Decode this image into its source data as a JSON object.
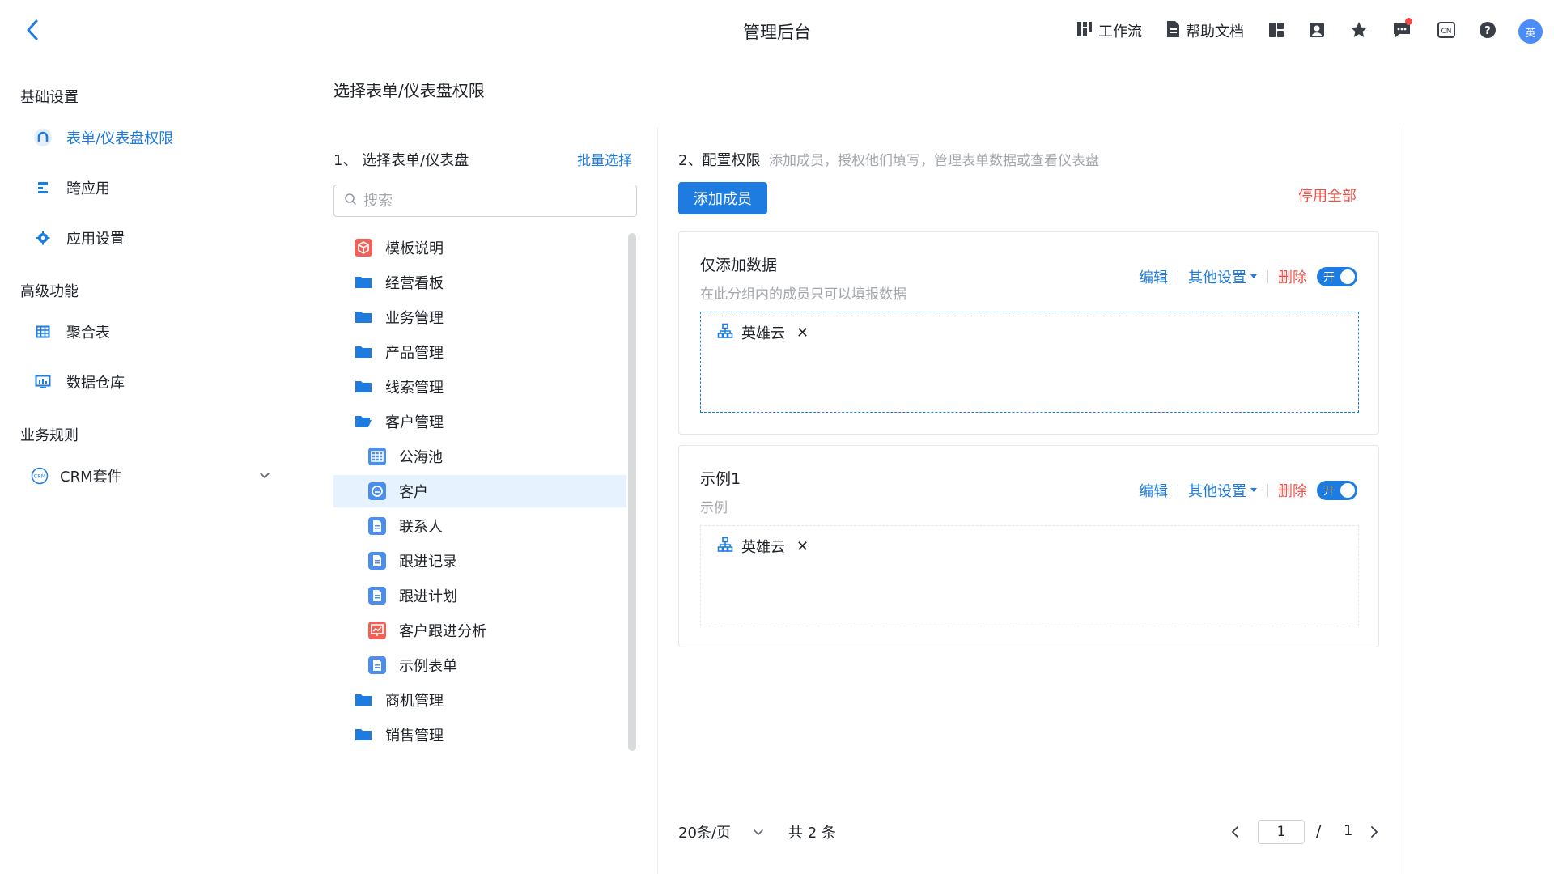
{
  "header": {
    "title": "管理后台",
    "workflow_label": "工作流",
    "help_label": "帮助文档",
    "avatar_text": "英"
  },
  "sidebar": {
    "sections": [
      {
        "title": "基础设置"
      },
      {
        "title": "高级功能"
      },
      {
        "title": "业务规则"
      }
    ],
    "items": [
      {
        "label": "表单/仪表盘权限",
        "icon": "permission-icon",
        "active": true
      },
      {
        "label": "跨应用",
        "icon": "cross-app-icon"
      },
      {
        "label": "应用设置",
        "icon": "gear-icon"
      },
      {
        "label": "聚合表",
        "icon": "table-icon"
      },
      {
        "label": "数据仓库",
        "icon": "monitor-chart-icon"
      },
      {
        "label": "CRM套件",
        "icon": "crm-icon"
      }
    ]
  },
  "page": {
    "title": "选择表单/仪表盘权限"
  },
  "select_panel": {
    "title": "1、 选择表单/仪表盘",
    "batch_label": "批量选择",
    "search_placeholder": "搜索",
    "tree": [
      {
        "label": "模板说明",
        "type": "cube",
        "level": 0
      },
      {
        "label": "经营看板",
        "type": "folder",
        "level": 0
      },
      {
        "label": "业务管理",
        "type": "folder",
        "level": 0
      },
      {
        "label": "产品管理",
        "type": "folder",
        "level": 0
      },
      {
        "label": "线索管理",
        "type": "folder",
        "level": 0
      },
      {
        "label": "客户管理",
        "type": "folder-open",
        "level": 0
      },
      {
        "label": "公海池",
        "type": "grid",
        "level": 1
      },
      {
        "label": "客户",
        "type": "circle-form",
        "level": 1,
        "selected": true
      },
      {
        "label": "联系人",
        "type": "doc",
        "level": 1
      },
      {
        "label": "跟进记录",
        "type": "doc",
        "level": 1
      },
      {
        "label": "跟进计划",
        "type": "doc",
        "level": 1
      },
      {
        "label": "客户跟进分析",
        "type": "chart",
        "level": 1
      },
      {
        "label": "示例表单",
        "type": "doc",
        "level": 1
      },
      {
        "label": "商机管理",
        "type": "folder",
        "level": 0
      },
      {
        "label": "销售管理",
        "type": "folder",
        "level": 0
      }
    ]
  },
  "config_panel": {
    "title": "2、配置权限",
    "description": "添加成员，授权他们填写，管理表单数据或查看仪表盘",
    "add_member_label": "添加成员",
    "disable_all_label": "停用全部",
    "edit_label": "编辑",
    "other_settings_label": "其他设置",
    "delete_label": "删除",
    "toggle_on_label": "开",
    "groups": [
      {
        "title": "仅添加数据",
        "desc": "在此分组内的成员只可以填报数据",
        "members": [
          "英雄云"
        ],
        "enabled": true
      },
      {
        "title": "示例1",
        "desc": "示例",
        "members": [
          "英雄云"
        ],
        "enabled": true
      }
    ]
  },
  "pagination": {
    "page_size": "20条/页",
    "total": "共 2 条",
    "current_page": "1",
    "slash": "/",
    "total_pages": "1"
  },
  "colors": {
    "accent": "#1e7ce0",
    "danger": "#e9524a",
    "selected_bg": "#e6f2fd"
  }
}
